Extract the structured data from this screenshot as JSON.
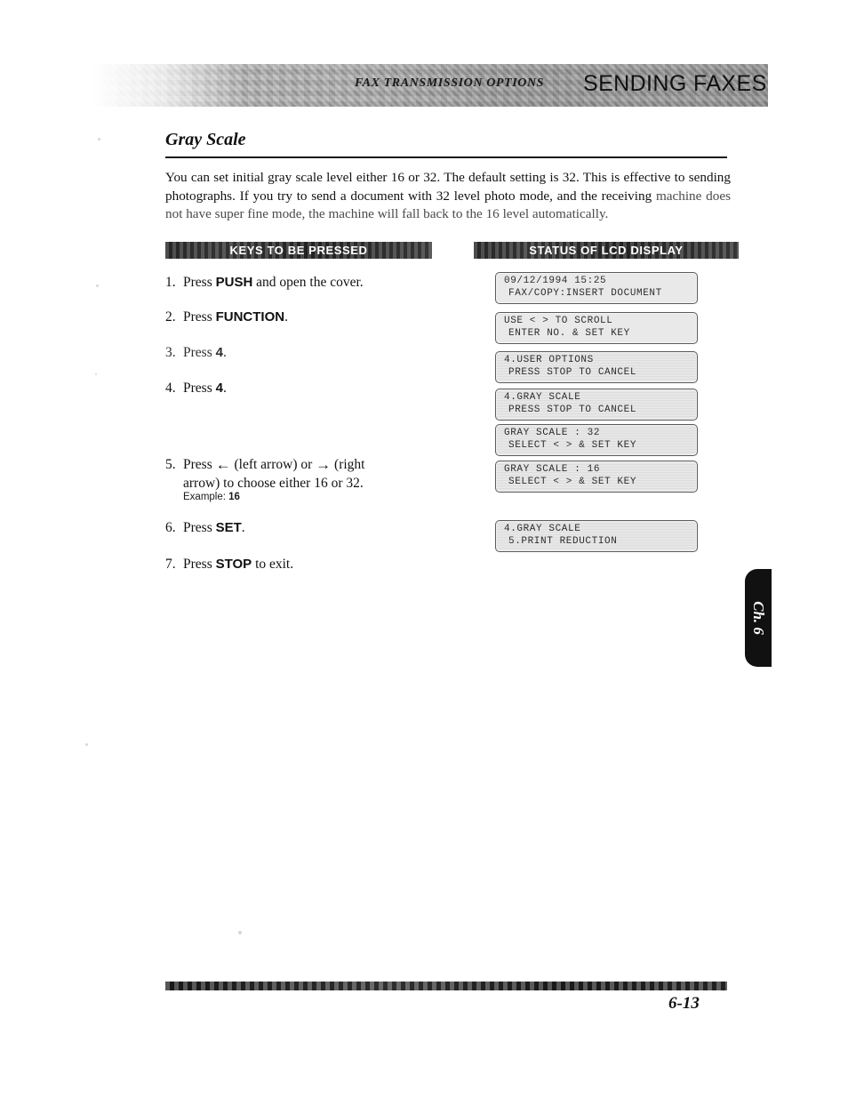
{
  "header": {
    "kicker": "FAX TRANSMISSION OPTIONS",
    "title": "SENDING FAXES"
  },
  "section": {
    "title": "Gray Scale",
    "intro_line1": "You can set initial gray scale level either 16 or 32. The default setting is 32. This is effective to",
    "intro_line2": "sending photographs. If you try to send a document with 32 level photo mode, and the receiving",
    "intro_line3": "machine does not have super fine mode, the machine will fall back to the 16 level automatically."
  },
  "columns": {
    "keys_heading": "KEYS TO BE PRESSED",
    "status_heading": "STATUS OF LCD DISPLAY"
  },
  "steps": [
    {
      "num": "1.",
      "pre": "Press ",
      "key": "PUSH",
      "post": " and open the cover."
    },
    {
      "num": "2.",
      "pre": "Press ",
      "key": "FUNCTION",
      "post": "."
    },
    {
      "num": "3.",
      "pre": "Press ",
      "key": "4",
      "post": "."
    },
    {
      "num": "4.",
      "pre": "Press ",
      "key": "4",
      "post": "."
    },
    {
      "num": "5.",
      "pre": "Press ",
      "key": "",
      "post": ""
    },
    {
      "num": "6.",
      "pre": "Press ",
      "key": "SET",
      "post": "."
    },
    {
      "num": "7.",
      "pre": "Press ",
      "key": "STOP",
      "post": " to exit."
    }
  ],
  "step5": {
    "num": "5.",
    "text_a": "Press ",
    "left_arrow": "←",
    "text_b": " (left  arrow)  or ",
    "right_arrow": "→",
    "text_c": " (right",
    "line2": "arrow) to choose either 16 or 32.",
    "example_label": "Example:",
    "example_value": "16"
  },
  "lcd_displays": [
    {
      "line1": "09/12/1994 15:25",
      "line2": "FAX/COPY:INSERT DOCUMENT"
    },
    {
      "line1": "USE < > TO SCROLL",
      "line2": "ENTER NO. & SET KEY"
    },
    {
      "line1": "4.USER OPTIONS",
      "line2": "PRESS STOP TO CANCEL"
    },
    {
      "line1": "4.GRAY SCALE",
      "line2": "PRESS STOP TO CANCEL"
    },
    {
      "line1": "GRAY SCALE : 32",
      "line2": "SELECT < > & SET KEY"
    },
    {
      "line1": "GRAY SCALE : 16",
      "line2": "SELECT < > & SET KEY"
    },
    {
      "line1": "4.GRAY SCALE",
      "line2": "5.PRINT REDUCTION"
    }
  ],
  "chapter_tab": "Ch. 6",
  "page_number": "6-13"
}
